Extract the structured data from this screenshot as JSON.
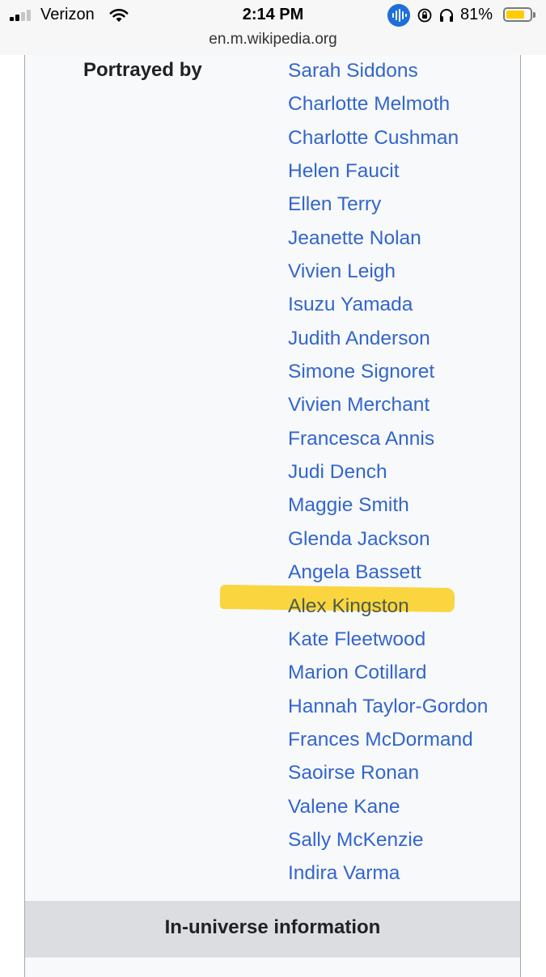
{
  "status_bar": {
    "carrier": "Verizon",
    "time": "2:14 PM",
    "battery_percent": "81%",
    "battery_level": 0.81,
    "icons": [
      "signal-icon",
      "wifi-icon",
      "voice-icon",
      "rotation-lock-icon",
      "headphones-icon",
      "battery-icon"
    ]
  },
  "url_bar": {
    "url": "en.m.wikipedia.org"
  },
  "infobox": {
    "portrayed_by_label": "Portrayed by",
    "actors": [
      "Sarah Siddons",
      "Charlotte Melmoth",
      "Charlotte Cushman",
      "Helen Faucit",
      "Ellen Terry",
      "Jeanette Nolan",
      "Vivien Leigh",
      "Isuzu Yamada",
      "Judith Anderson",
      "Simone Signoret",
      "Vivien Merchant",
      "Francesca Annis",
      "Judi Dench",
      "Maggie Smith",
      "Glenda Jackson",
      "Angela Bassett",
      "Alex Kingston",
      "Kate Fleetwood",
      "Marion Cotillard",
      "Hannah Taylor-Gordon",
      "Frances McDormand",
      "Saoirse Ronan",
      "Valene Kane",
      "Sally McKenzie",
      "Indira Varma"
    ],
    "highlighted_actor": "Alex Kingston",
    "highlight_color": "#fad02a",
    "link_color": "#3366cc",
    "section_header": "In-universe information"
  }
}
